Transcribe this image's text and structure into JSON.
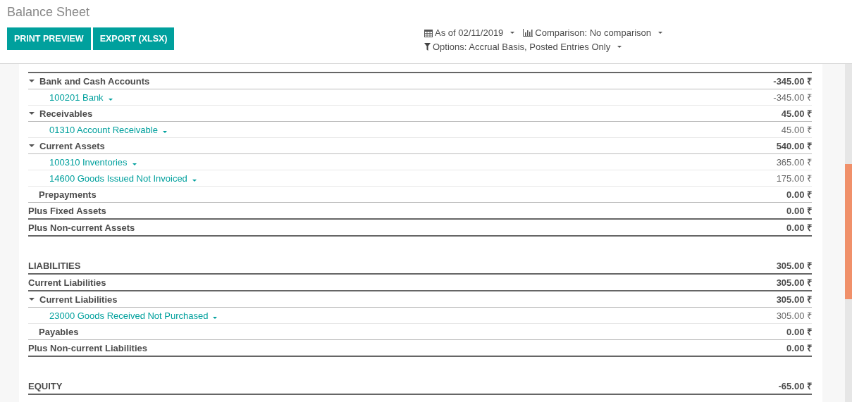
{
  "title": "Balance Sheet",
  "buttons": [
    "PRINT PREVIEW",
    "EXPORT (XLSX)"
  ],
  "filters": {
    "date": "As of 02/11/2019",
    "comparison": "Comparison: No comparison",
    "options": "Options: Accrual Basis, Posted Entries Only"
  },
  "rows": [
    {
      "kind": "group",
      "name": "Bank and Cash Accounts",
      "amount": "-345.00 ₹",
      "expanded": true
    },
    {
      "kind": "account",
      "name": "100201 Bank",
      "amount": "-345.00 ₹"
    },
    {
      "kind": "group",
      "name": "Receivables",
      "amount": "45.00 ₹",
      "expanded": true
    },
    {
      "kind": "account",
      "name": "01310 Account Receivable",
      "amount": "45.00 ₹"
    },
    {
      "kind": "group",
      "name": "Current Assets",
      "amount": "540.00 ₹",
      "expanded": true
    },
    {
      "kind": "account",
      "name": "100310 Inventories",
      "amount": "365.00 ₹"
    },
    {
      "kind": "account",
      "name": "14600 Goods Issued Not Invoiced",
      "amount": "175.00 ₹"
    },
    {
      "kind": "subline",
      "name": "Prepayments",
      "amount": "0.00 ₹"
    },
    {
      "kind": "total",
      "name": "Plus Fixed Assets",
      "amount": "0.00 ₹"
    },
    {
      "kind": "total",
      "name": "Plus Non-current Assets",
      "amount": "0.00 ₹"
    },
    {
      "kind": "section",
      "name": "LIABILITIES",
      "amount": "305.00 ₹"
    },
    {
      "kind": "total",
      "name": "Current Liabilities",
      "amount": "305.00 ₹"
    },
    {
      "kind": "group",
      "name": "Current Liabilities",
      "amount": "305.00 ₹",
      "expanded": true
    },
    {
      "kind": "account",
      "name": "23000 Goods Received Not Purchased",
      "amount": "305.00 ₹"
    },
    {
      "kind": "subline",
      "name": "Payables",
      "amount": "0.00 ₹"
    },
    {
      "kind": "total",
      "name": "Plus Non-current Liabilities",
      "amount": "0.00 ₹"
    },
    {
      "kind": "section",
      "name": "EQUITY",
      "amount": "-65.00 ₹"
    }
  ]
}
